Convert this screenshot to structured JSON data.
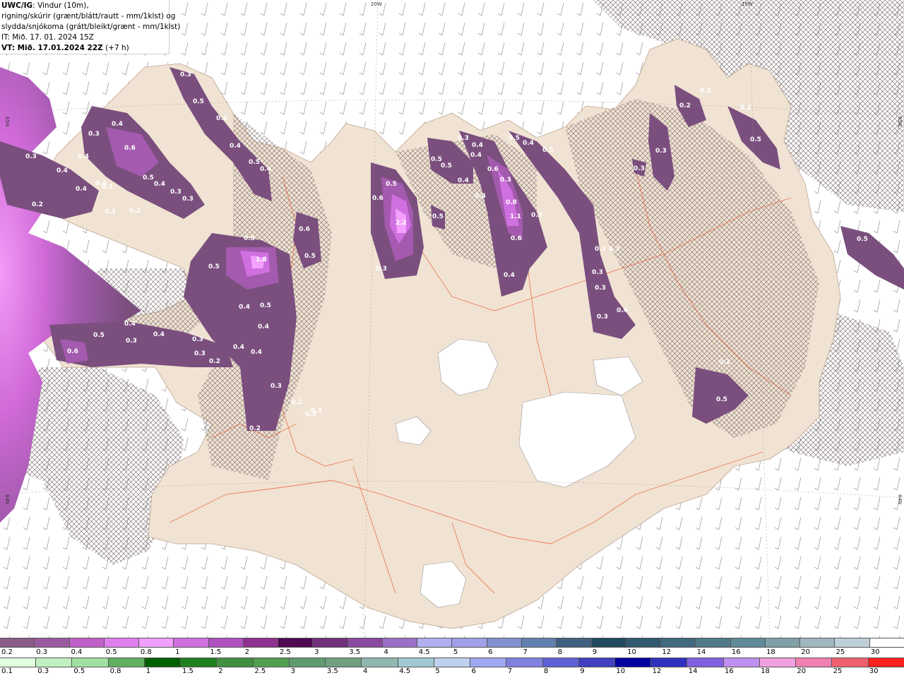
{
  "header": {
    "model": "UWC/IG",
    "line1_rest": ": Vindur (10m),",
    "line2": "rigning/skúrir (grænt/blátt/rautt - mm/1klst) og",
    "line3": "slydda/snjókoma (grátt/bleikt/grænt - mm/1klst)",
    "it_line": "IT: Mið. 17. 01. 2024 15Z",
    "vt_label": "VT: Mið. 17.01.2024 22Z",
    "vt_suffix": " (+7 h)"
  },
  "grid_labels": {
    "lon_20w": "20W",
    "lon_15w": "15W",
    "lat_65n_left": "65N",
    "lat_65n_right": "65N",
    "lat_64n_left": "64N",
    "lat_64n_right": "64N"
  },
  "precip_values": [
    {
      "v": "0.3"
    },
    {
      "v": "0.5"
    },
    {
      "v": "0.4"
    },
    {
      "v": "0.4"
    },
    {
      "v": "0.5"
    },
    {
      "v": "0.4"
    },
    {
      "v": "0.4"
    },
    {
      "v": "0.4"
    },
    {
      "v": "0.3"
    },
    {
      "v": "0.4"
    },
    {
      "v": "0.6"
    },
    {
      "v": "0.3"
    },
    {
      "v": "0.4"
    },
    {
      "v": "0.4"
    },
    {
      "v": "0.2"
    },
    {
      "v": "0.5"
    },
    {
      "v": "0.4"
    },
    {
      "v": "0.3"
    },
    {
      "v": "0.3"
    },
    {
      "v": "0.2"
    },
    {
      "v": "0.3"
    },
    {
      "v": "0.2"
    },
    {
      "v": "0.3"
    },
    {
      "v": "0.5"
    },
    {
      "v": "0.6"
    },
    {
      "v": "0.5"
    },
    {
      "v": "1.8"
    },
    {
      "v": "0.5"
    },
    {
      "v": "0.4"
    },
    {
      "v": "0.5"
    },
    {
      "v": "0.4"
    },
    {
      "v": "0.4"
    },
    {
      "v": "0.4"
    },
    {
      "v": "0.4"
    },
    {
      "v": "0.5"
    },
    {
      "v": "0.4"
    },
    {
      "v": "0.3"
    },
    {
      "v": "0.3"
    },
    {
      "v": "0.6"
    },
    {
      "v": "0.3"
    },
    {
      "v": "0.2"
    },
    {
      "v": "0.3"
    },
    {
      "v": "0.3"
    },
    {
      "v": "0.2"
    },
    {
      "v": "0.3"
    },
    {
      "v": "0.2"
    },
    {
      "v": "0.6"
    },
    {
      "v": "0.5"
    },
    {
      "v": "2.2"
    },
    {
      "v": "0.3"
    },
    {
      "v": "0.5"
    },
    {
      "v": "0.5"
    },
    {
      "v": "0.3"
    },
    {
      "v": "0.4"
    },
    {
      "v": "0.4"
    },
    {
      "v": "0.5"
    },
    {
      "v": "0.6"
    },
    {
      "v": "0.3"
    },
    {
      "v": "0.4"
    },
    {
      "v": "0.4"
    },
    {
      "v": "0.5"
    },
    {
      "v": "0.4"
    },
    {
      "v": "0.8"
    },
    {
      "v": "1.1"
    },
    {
      "v": "0.3"
    },
    {
      "v": "0.6"
    },
    {
      "v": "0.4"
    },
    {
      "v": "0.5"
    },
    {
      "v": "0.3"
    },
    {
      "v": "0.3"
    },
    {
      "v": "0.3"
    },
    {
      "v": "0.3"
    },
    {
      "v": "0.4"
    },
    {
      "v": "0.3"
    },
    {
      "v": "0.3"
    },
    {
      "v": "0.3"
    },
    {
      "v": "0.2"
    },
    {
      "v": "0.2"
    },
    {
      "v": "0.5"
    },
    {
      "v": "0.5"
    },
    {
      "v": "0.1"
    },
    {
      "v": "0.5"
    },
    {
      "v": "0.2"
    }
  ],
  "snow_scale": {
    "labels": [
      "0.2",
      "0.3",
      "0.4",
      "0.5",
      "0.8",
      "1",
      "1.5",
      "2",
      "2.5",
      "3",
      "3.5",
      "4",
      "4.5",
      "5",
      "6",
      "7",
      "8",
      "9",
      "10",
      "12",
      "14",
      "16",
      "18",
      "20",
      "25",
      "30"
    ],
    "colors": [
      "#8a5a8a",
      "#9a5aa0",
      "#c060c8",
      "#e080f0",
      "#f0a0ff",
      "#d070e0",
      "#b050c0",
      "#903090",
      "#500850",
      "#70307a",
      "#8a4aa0",
      "#9a70c8",
      "#b0b0f0",
      "#a0a0e8",
      "#8090d0",
      "#6080b0",
      "#406080",
      "#204a60",
      "#305a70",
      "#406a80",
      "#507a88",
      "#608a98",
      "#80a0a8",
      "#a0b8c0",
      "#c0d0d8",
      "#ffffff"
    ]
  },
  "rain_scale": {
    "labels": [
      "0.1",
      "0.3",
      "0.5",
      "0.8",
      "1",
      "1.5",
      "2",
      "2.5",
      "3",
      "3.5",
      "4",
      "4.5",
      "5",
      "6",
      "7",
      "8",
      "9",
      "10",
      "12",
      "14",
      "16",
      "18",
      "20",
      "25",
      "30"
    ],
    "colors": [
      "#e0ffe0",
      "#c0f0c0",
      "#a0e0a0",
      "#60b060",
      "#006000",
      "#208020",
      "#409040",
      "#50a050",
      "#609a70",
      "#70a080",
      "#90b8b0",
      "#a0c8d0",
      "#c0d0f0",
      "#a0a8f0",
      "#8080e0",
      "#6060d8",
      "#4040c0",
      "#0000a0",
      "#3030c0",
      "#8060e0",
      "#c090f0",
      "#f0a0e0",
      "#f080b0",
      "#f06070",
      "#ff2020"
    ]
  },
  "colors": {
    "land": "#f1e3d3",
    "precip_light": "#7a4f7e",
    "precip_mid": "#a45aae",
    "precip_strong": "#d070e0",
    "precip_peak": "#f4a0ff",
    "roads": "#e8613a",
    "hatch": "#7a6a6a"
  }
}
